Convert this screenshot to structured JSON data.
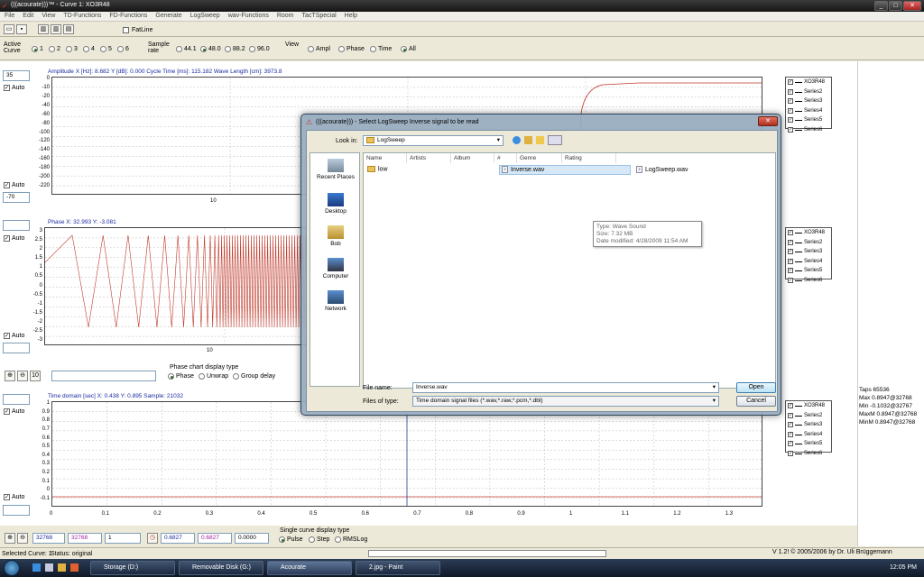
{
  "window": {
    "title": "(((acourate)))™ - Curve 1: XO3R48"
  },
  "menu": [
    "File",
    "Edit",
    "View",
    "TD-Functions",
    "FD-Functions",
    "Generate",
    "LogSweep",
    "wav-Functions",
    "Room",
    "TacTSpecial",
    "Help"
  ],
  "toolbar": {
    "fatline_label": "FatLine"
  },
  "options": {
    "active_curve_label": "Active Curve",
    "curves": [
      "1",
      "2",
      "3",
      "4",
      "5",
      "6"
    ],
    "selected_curve": "1",
    "sample_rate_label": "Sample rate",
    "sample_rates": [
      "44.1",
      "48.0",
      "88.2",
      "96.0"
    ],
    "selected_rate": "48.0",
    "view_label": "View",
    "views": [
      "Ampl",
      "Phase",
      "Time",
      "All"
    ],
    "selected_view": "All"
  },
  "amplitude": {
    "header": "Amplitude   X [Hz]: 8.682   Y [dB]: 0.000   Cycle Time [ms]: 115.182   Wave Length [cm]: 3973.8",
    "top_value": "35",
    "bottom_value": "-70",
    "auto_label": "Auto",
    "yticks": [
      "0",
      "-10",
      "-20",
      "-40",
      "-60",
      "-80",
      "-100",
      "-120",
      "-140",
      "-160",
      "-180",
      "-200",
      "-220"
    ],
    "xticks": [
      "10"
    ]
  },
  "phase": {
    "header": "Phase   X: 32.993   Y: -3.081",
    "auto_label": "Auto",
    "yticks": [
      "3",
      "2.5",
      "2",
      "1.5",
      "1",
      "0.5",
      "0",
      "-0.5",
      "-1",
      "-1.5",
      "-2",
      "-2.5",
      "-3"
    ],
    "xticks": [
      "10"
    ]
  },
  "phase_controls": {
    "display_type_label": "Phase chart display type",
    "options": [
      "Phase",
      "Unwrap",
      "Group delay"
    ],
    "selected": "Phase",
    "ten_label": "10"
  },
  "time": {
    "header": "Time domain [sec]   X: 0.438   Y: 0.895   Sample: 21032",
    "auto_label": "Auto",
    "yticks": [
      "1",
      "0.9",
      "0.8",
      "0.7",
      "0.6",
      "0.5",
      "0.4",
      "0.3",
      "0.2",
      "0.1",
      "0",
      "-0.1"
    ],
    "xticks": [
      "0",
      "0.1",
      "0.2",
      "0.3",
      "0.4",
      "0.5",
      "0.6",
      "0.7",
      "0.8",
      "0.9",
      "1",
      "1.1",
      "1.2",
      "1.3"
    ]
  },
  "legend": [
    "XO3R48",
    "Series2",
    "Series3",
    "Series4",
    "Series5",
    "Series6"
  ],
  "stats": {
    "taps": "Taps 65536",
    "max": "Max 0.8947@32768",
    "min": "Min -0.1032@32767",
    "maxm": "MaxM 0.8947@32768",
    "minm": "MinM 0.8947@32768"
  },
  "bottom_controls": {
    "field1": "32768",
    "field2": "32768",
    "field3": "1",
    "field4": "0.6827",
    "field5": "0.6827",
    "field6": "0.0000",
    "single_curve_label": "Single curve display type",
    "options": [
      "Pulse",
      "Step",
      "RMSLog"
    ],
    "selected": "Pulse"
  },
  "status": {
    "selected_curve": "Selected Curve: 1",
    "status": "Status: original",
    "version": "V 1.2! © 2005/2006 by Dr. Uli Brüggemann"
  },
  "dialog": {
    "title": "(((acourate))) - Select LogSweep Inverse signal to be read",
    "look_in_label": "Look in:",
    "look_in_value": "LogSweep",
    "places": [
      "Recent Places",
      "Desktop",
      "Bob",
      "Computer",
      "Network"
    ],
    "columns": [
      "Name",
      "Artists",
      "Album",
      "#",
      "Genre",
      "Rating"
    ],
    "items": [
      {
        "name": "low",
        "type": "folder"
      },
      {
        "name": "Inverse.wav",
        "type": "wav"
      },
      {
        "name": "LogSweep.wav",
        "type": "wav"
      }
    ],
    "tooltip": [
      "Type: Wave Sound",
      "Size: 7.32 MB",
      "Date modified: 4/28/2009 11:54 AM"
    ],
    "file_name_label": "File name:",
    "file_name_value": "Inverse.wav",
    "file_type_label": "Files of type:",
    "file_type_value": "Time domain signal files (*.wav,*.raw,*.pcm,*.dbl)",
    "open_label": "Open",
    "cancel_label": "Cancel"
  },
  "taskbar": {
    "tasks": [
      "Storage (D:)",
      "Removable Disk (G:)",
      "Acourate",
      "2.jpg - Paint"
    ],
    "clock": "12:05 PM"
  },
  "colors": {
    "curve": "#c0392b",
    "impulse": "#1f3d8a",
    "header_text": "#1a2aa0"
  }
}
